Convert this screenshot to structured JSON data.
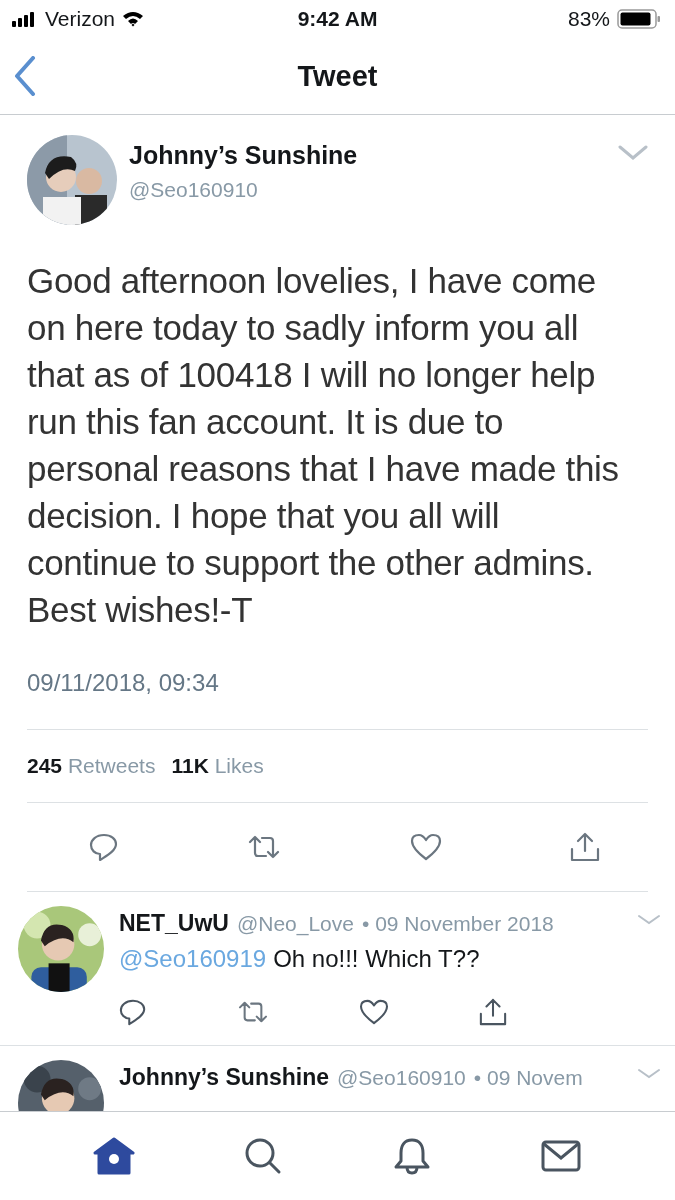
{
  "status_bar": {
    "carrier": "Verizon",
    "time": "9:42 AM",
    "battery": "83%"
  },
  "nav": {
    "title": "Tweet"
  },
  "tweet": {
    "name": "Johnny’s Sunshine",
    "handle": "@Seo160910",
    "text": "Good afternoon lovelies, I have come on here today to sadly inform you all that as of 100418 I will no longer help run this fan account. It is due to personal reasons that I have made this decision. I hope that you all will continue to support the other admins. Best wishes!-T",
    "timestamp": "09/11/2018, 09:34",
    "retweets": "245",
    "retweets_label": "Retweets",
    "likes": "11K",
    "likes_label": "Likes"
  },
  "replies": [
    {
      "name": "NET_UwU",
      "handle": "@Neo_Love",
      "date": "• 09 November 2018",
      "mention": "@Seo160919",
      "text": "Oh no!!! Which T??"
    },
    {
      "name": "Johnny’s Sunshine",
      "handle": "@Seo160910",
      "date": "• 09 Novem"
    }
  ],
  "tab_bar": [
    {
      "kind": "home",
      "selected": true
    },
    {
      "kind": "search",
      "selected": false
    },
    {
      "kind": "bell",
      "selected": false
    },
    {
      "kind": "mail",
      "selected": false
    }
  ]
}
